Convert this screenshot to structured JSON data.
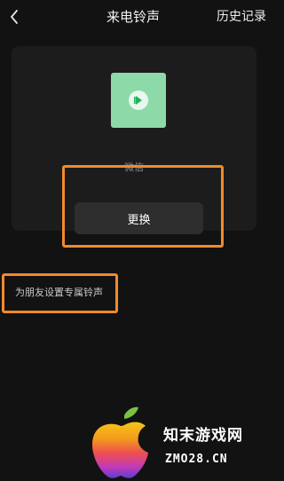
{
  "header": {
    "back_icon": "chevron-left-icon",
    "title": "来电铃声",
    "history_label": "历史记录"
  },
  "ringtone_card": {
    "cover_icon": "music-play-icon",
    "cover_color": "#8ed9a8",
    "name": "微信",
    "change_button_label": "更换"
  },
  "friend_ringtone": {
    "label": "为朋友设置专属铃声"
  },
  "highlight_color": "#f2892c",
  "watermark": {
    "title": "知末游戏网",
    "url": "ZMO28.CN"
  }
}
